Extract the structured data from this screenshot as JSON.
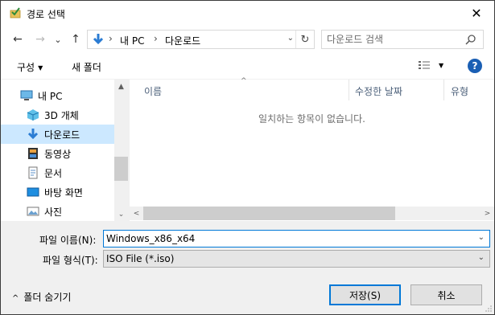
{
  "window": {
    "title": "경로 선택",
    "close_glyph": "✕",
    "title_icon": "folder-check-icon"
  },
  "nav": {
    "back": "←",
    "forward": "→",
    "recent": "⌄",
    "up": "↑",
    "address": {
      "root_icon": "download-arrow-icon",
      "crumbs": [
        "내 PC",
        "다운로드"
      ],
      "separator": "›",
      "dropdown": "⌄",
      "refresh": "↻"
    },
    "search": {
      "placeholder": "다운로드 검색"
    }
  },
  "toolbar": {
    "organize": "구성",
    "organize_caret": "▼",
    "new_folder": "새 폴더",
    "view_caret": "▼",
    "help": "?"
  },
  "sidebar": {
    "items": [
      {
        "label": "내 PC",
        "icon": "monitor-icon"
      },
      {
        "label": "3D 개체",
        "icon": "cube-icon"
      },
      {
        "label": "다운로드",
        "icon": "download-arrow-icon",
        "selected": true
      },
      {
        "label": "동영상",
        "icon": "film-icon"
      },
      {
        "label": "문서",
        "icon": "document-icon"
      },
      {
        "label": "바탕 화면",
        "icon": "desktop-icon"
      },
      {
        "label": "사진",
        "icon": "picture-icon"
      }
    ],
    "scroll_up": "▲",
    "scroll_down": "⌄"
  },
  "filelist": {
    "columns": [
      "이름",
      "수정한 날짜",
      "유형"
    ],
    "sort_indicator": "^",
    "empty_message": "일치하는 항목이 없습니다.",
    "scroll_left": "<",
    "scroll_right": ">"
  },
  "form": {
    "filename_label": "파일 이름(N):",
    "filename_value": "Windows_x86_x64",
    "filetype_label": "파일 형식(T):",
    "filetype_value": "ISO File (*.iso)",
    "combo_arrow": "⌄"
  },
  "footer": {
    "hide_folders": "폴더 숨기기",
    "hide_caret": "^",
    "save": "저장(S)",
    "cancel": "취소"
  },
  "colors": {
    "accent": "#0078d7",
    "selection": "#cce8ff",
    "help": "#1a5fb4"
  }
}
